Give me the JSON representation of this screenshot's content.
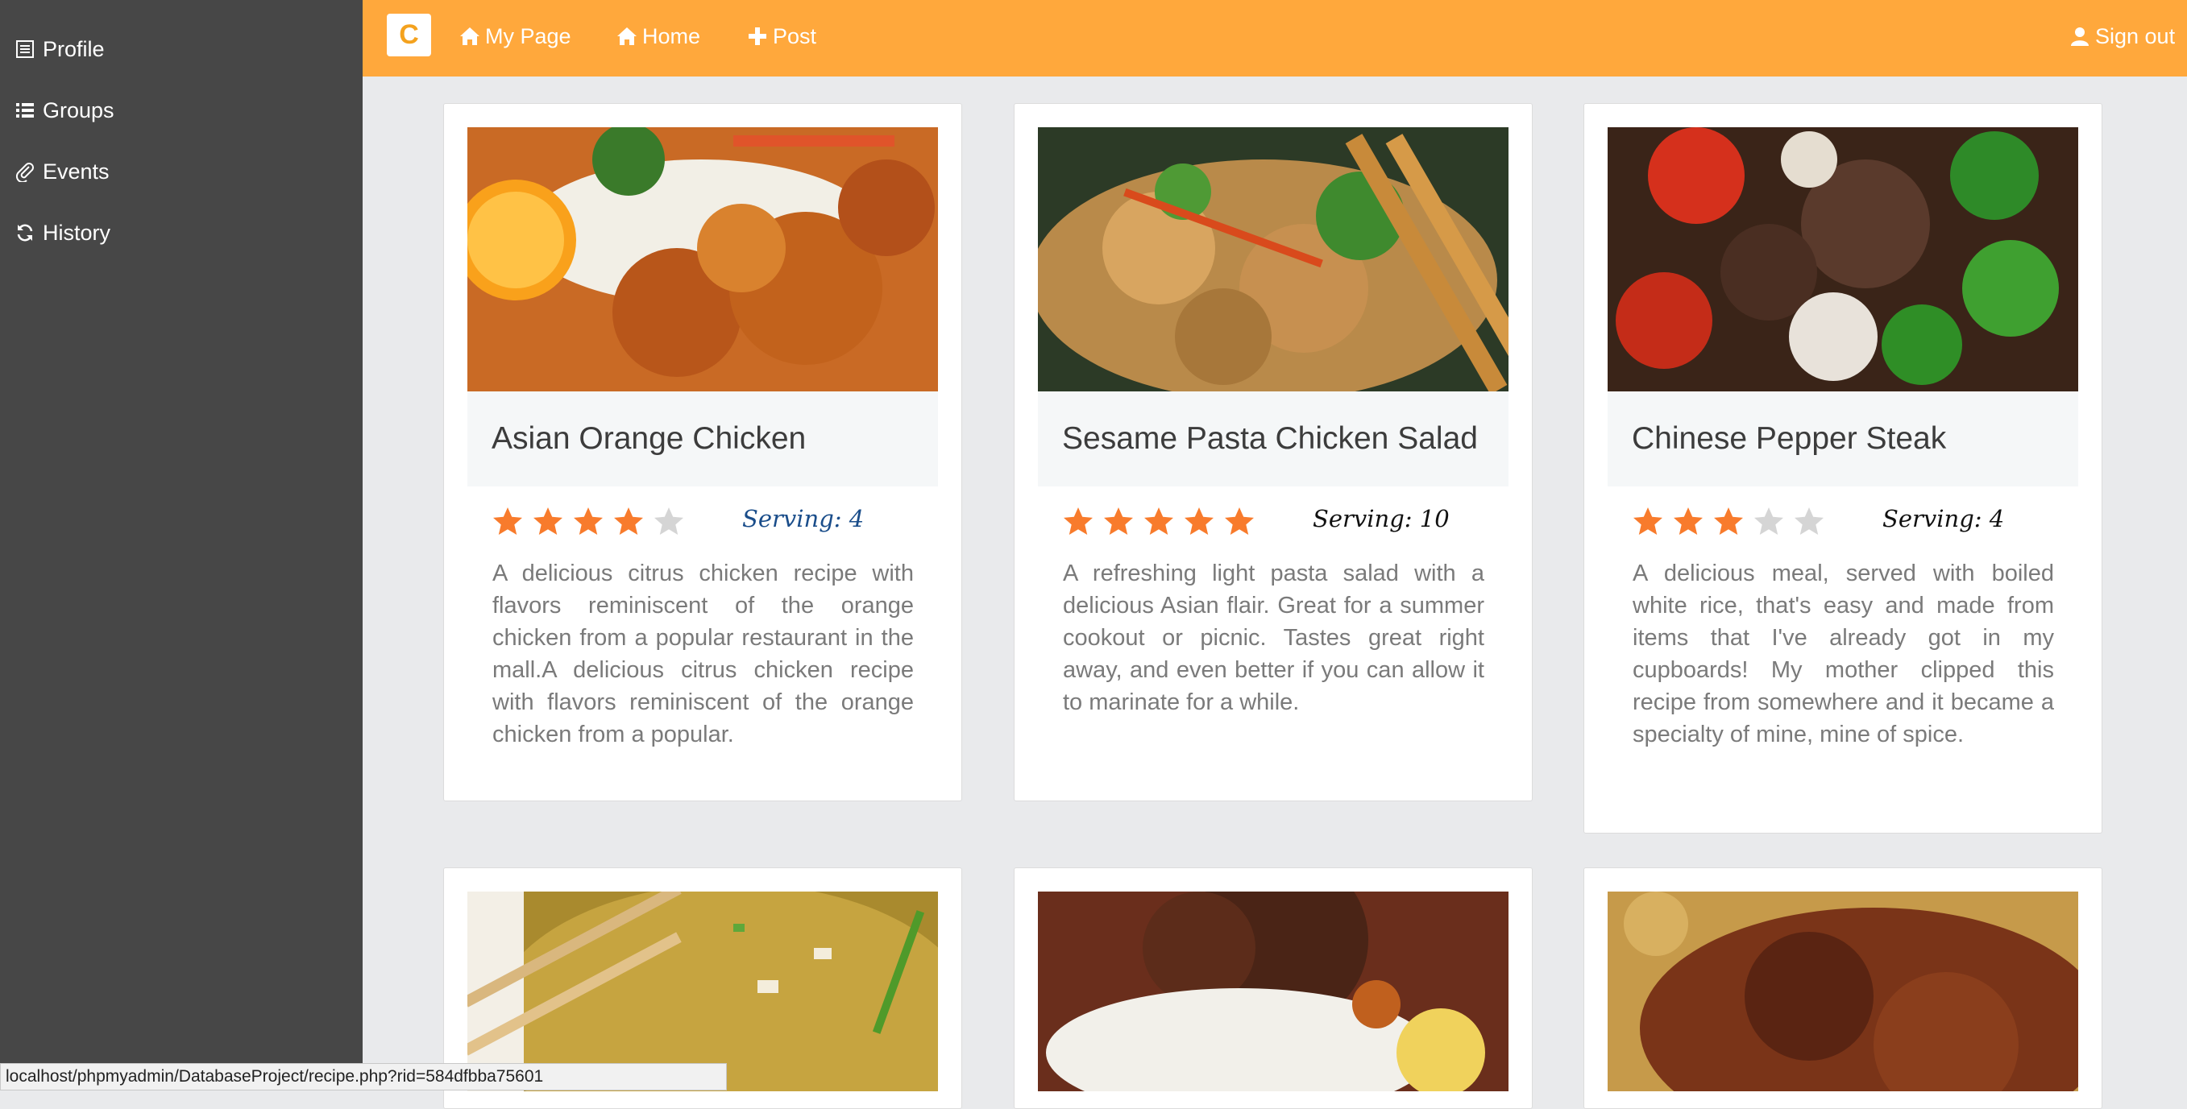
{
  "sidebar": {
    "items": [
      {
        "label": "Profile",
        "icon": "list-alt-icon"
      },
      {
        "label": "Groups",
        "icon": "list-icon"
      },
      {
        "label": "Events",
        "icon": "paperclip-icon"
      },
      {
        "label": "History",
        "icon": "refresh-icon"
      }
    ]
  },
  "topbar": {
    "logo": "C",
    "nav": [
      {
        "label": "My Page",
        "icon": "home-icon"
      },
      {
        "label": "Home",
        "icon": "home-icon"
      },
      {
        "label": "Post",
        "icon": "plus-icon"
      }
    ],
    "sign_out": "Sign out"
  },
  "cards": [
    {
      "title": "Asian Orange Chicken",
      "rating": 4,
      "serving": "Serving: 4",
      "serving_color": "#1a4d8a",
      "description": "A delicious citrus chicken recipe with flavors reminiscent of the orange chicken from a popular restaurant in the mall.A delicious citrus chicken recipe with flavors reminiscent of the orange chicken from a popular."
    },
    {
      "title": "Sesame Pasta Chicken Salad",
      "rating": 5,
      "serving": "Serving: 10",
      "serving_color": "#111111",
      "description": "A refreshing light pasta salad with a delicious Asian flair. Great for a summer cookout or picnic. Tastes great right away, and even better if you can allow it to marinate for a while."
    },
    {
      "title": "Chinese Pepper Steak",
      "rating": 3,
      "serving": "Serving: 4",
      "serving_color": "#111111",
      "description": "A delicious meal, served with boiled white rice, that's easy and made from items that I've already got in my cupboards! My mother clipped this recipe from somewhere and it became a specialty of mine, mine of spice."
    }
  ],
  "status_url": "localhost/phpmyadmin/DatabaseProject/recipe.php?rid=584dfbba75601",
  "colors": {
    "accent": "#ffa83c",
    "sidebar": "#474747",
    "star_on": "#f87b2c",
    "star_off": "#d5d5d5"
  }
}
